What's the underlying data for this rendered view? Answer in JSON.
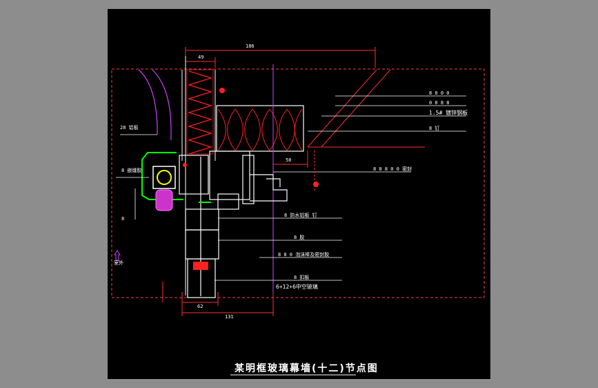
{
  "title": "某明框玻璃幕墙(十二)节点图",
  "dimensions": {
    "top_overall": "186",
    "top_insul": "49",
    "mid": "50",
    "bottom_a": "62",
    "bottom_b": "131"
  },
  "callouts_right": [
    "8 0 0 0",
    "0 0 8 8",
    "1.5# 镀锌钢板",
    "8 钉",
    "8 8 8 0 0 密封",
    "8 防水铝板 钉",
    "8 胶",
    "8 8 0 泡沫棒及密封胶",
    "8 扣板",
    "6+12+6中空玻璃"
  ],
  "callouts_left": [
    "28 铝板",
    "8 嵌缝胶",
    "8"
  ],
  "side_arrow_label": "室外",
  "colors": {
    "background": "#000000",
    "frame": "#ffffff",
    "dimension": "#ff3030",
    "magenta": "#cc44ff",
    "green": "#00ff00",
    "insulation": "#ff2020"
  }
}
